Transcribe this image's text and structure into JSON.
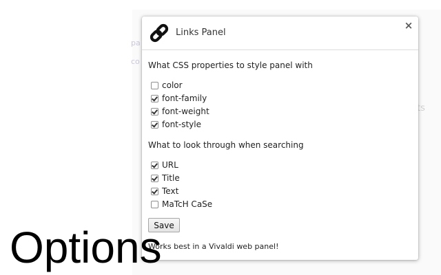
{
  "page": {
    "heading": "Options",
    "background_fragments": [
      "pa",
      "co",
      "ts"
    ]
  },
  "dialog": {
    "title": "Links Panel",
    "close_label": "×",
    "icon": "chain-link-icon"
  },
  "css_section": {
    "label": "What CSS properties to style panel with",
    "options": [
      {
        "label": "color",
        "checked": false
      },
      {
        "label": "font-family",
        "checked": true
      },
      {
        "label": "font-weight",
        "checked": true
      },
      {
        "label": "font-style",
        "checked": true
      }
    ]
  },
  "search_section": {
    "label": "What to look through when searching",
    "options": [
      {
        "label": "URL",
        "checked": true
      },
      {
        "label": "Title",
        "checked": true
      },
      {
        "label": "Text",
        "checked": true
      },
      {
        "label": "MaTcH CaSe",
        "checked": false
      }
    ]
  },
  "save_label": "Save",
  "footer_note": "Works best in a Vivaldi web panel!"
}
